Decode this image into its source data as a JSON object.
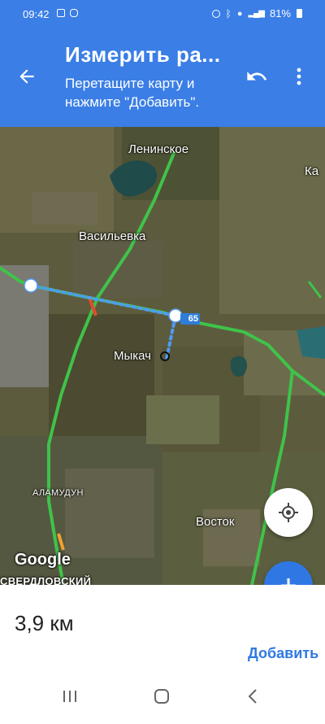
{
  "status_bar": {
    "time": "09:42",
    "battery": "81%",
    "icons": [
      "image-icon",
      "instagram-icon",
      "alarm-icon",
      "bluetooth-icon",
      "location-icon",
      "signal-icon",
      "battery-icon"
    ]
  },
  "header": {
    "title": "Измерить ра...",
    "subtitle": "Перетащите карту и нажмите \"Добавить\".",
    "accent_color": "#3a7ee6",
    "icons": [
      "back-arrow-icon",
      "undo-icon",
      "more-vert-icon"
    ]
  },
  "map": {
    "places": {
      "leninskoe": "Ленинское",
      "vasilevka": "Васильевка",
      "mykach": "Мыкач",
      "alamudun": "АЛАМУДУН",
      "vostok": "Восток",
      "sverdlovsky": "СВЕРДЛОВСКИЙ",
      "edge": "Ка"
    },
    "road_number": "65",
    "attribution": "Google",
    "measure_color": "#4f9bf5"
  },
  "bottom_sheet": {
    "distance": "3,9 км",
    "add_label": "Добавить",
    "accent_color": "#2f78e4"
  },
  "nav_bar": {
    "icons": [
      "recents-icon",
      "home-icon",
      "back-icon"
    ]
  }
}
